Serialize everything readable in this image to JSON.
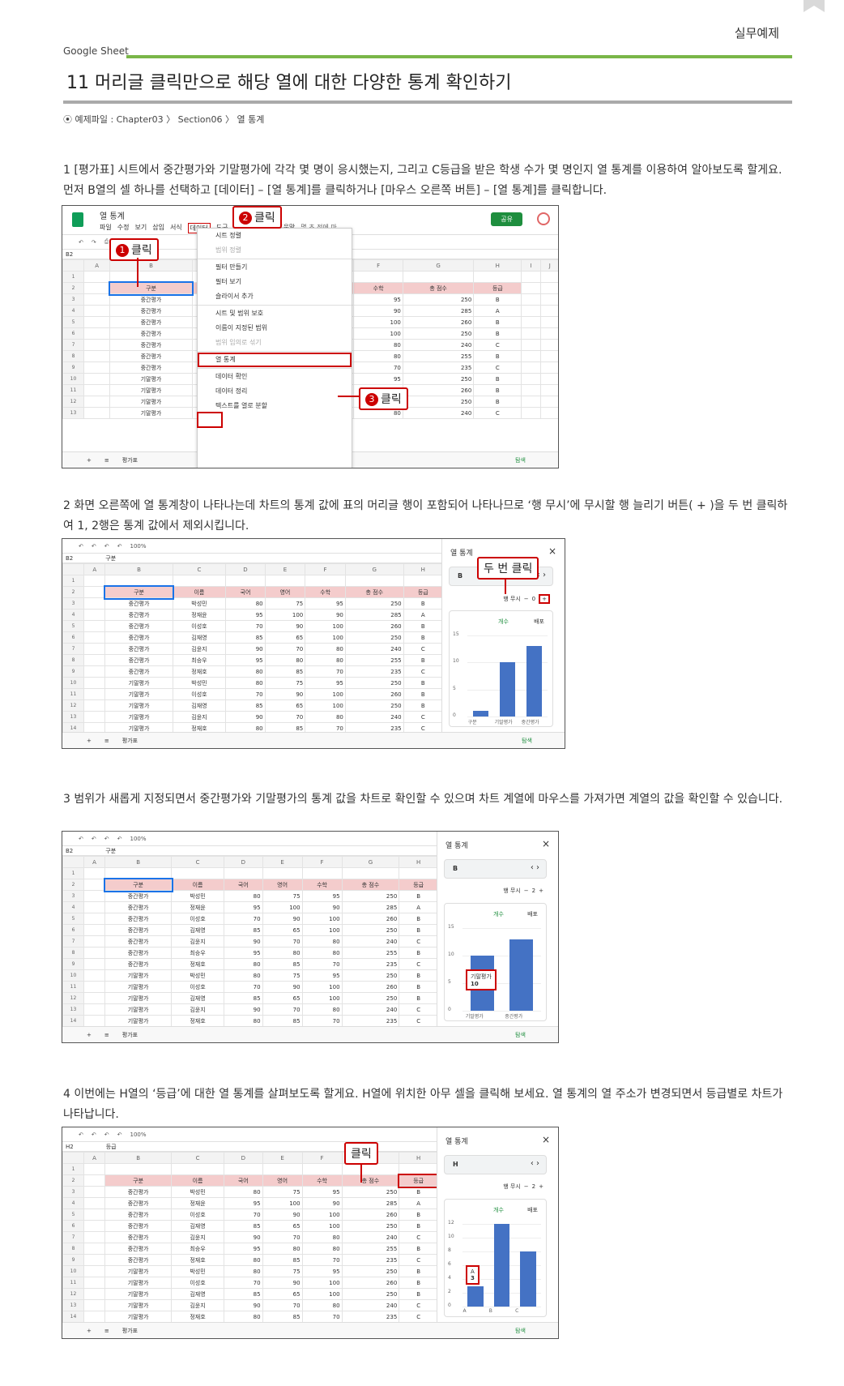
{
  "header": {
    "chapter": "실무예제",
    "app": "Google Sheet",
    "title": "11 머리글 클릭만으로 해당 열에 대한 다양한 통계 확인하기",
    "file": "⦿ 예제파일 : Chapter03 〉 Section06 〉 열 통계"
  },
  "steps": [
    "1 [평가표] 시트에서 중간평가와 기말평가에 각각 몇 명이 응시했는지, 그리고 C등급을 받은 학생 수가 몇 명인지 열 통계를 이용하여 알아보도록 할게요. 먼저 B열의 셀 하나를 선택하고 [데이터] – [열 통계]를 클릭하거나 [마우스 오른쪽 버튼] – [열 통계]를 클릭합니다.",
    "2 화면 오른쪽에 열 통계창이 나타나는데 차트의 통계 값에 표의 머리글 행이 포함되어 나타나므로 ‘행 무시’에 무시할 행 늘리기 버튼( + )을 두 번 클릭하여 1, 2행은 통계 값에서 제외시킵니다.",
    "3 범위가 새롭게 지정되면서 중간평가와 기말평가의 통계 값을 차트로 확인할 수 있으며 차트 계열에 마우스를 가져가면 계열의 값을 확인할 수 있습니다.",
    "4 이번에는 H열의 ‘등급’에 대한 열 통계를 살펴보도록 할게요. H열에 위치한 아무 셀을 클릭해 보세요. 열 통계의 열 주소가 변경되면서 등급별로 차트가 나타납니다."
  ],
  "sheet": {
    "doc_title": "열 통계",
    "menus": [
      "파일",
      "수정",
      "보기",
      "삽입",
      "서식",
      "데이터",
      "도구",
      "확장 프로그램",
      "도움말",
      "몇 초 전에 마..."
    ],
    "share": "공유",
    "tab": "평가표",
    "explore": "탐색",
    "zoom": "100%",
    "cellref1": "B2",
    "formula1": "구분",
    "cellref4": "H2",
    "formula4": "등급",
    "cols": [
      "A",
      "B",
      "C",
      "D",
      "E",
      "F",
      "G",
      "H",
      "I",
      "J"
    ],
    "headers": [
      "구분",
      "이름",
      "국어",
      "영어",
      "수학",
      "총 점수",
      "등급"
    ],
    "rows": [
      [
        "중간평가",
        "박성민",
        "80",
        "75",
        "95",
        "250",
        "B"
      ],
      [
        "중간평가",
        "정재윤",
        "95",
        "100",
        "90",
        "285",
        "A"
      ],
      [
        "중간평가",
        "이성호",
        "70",
        "90",
        "100",
        "260",
        "B"
      ],
      [
        "중간평가",
        "김재영",
        "85",
        "65",
        "100",
        "250",
        "B"
      ],
      [
        "중간평가",
        "김윤지",
        "90",
        "70",
        "80",
        "240",
        "C"
      ],
      [
        "중간평가",
        "최승우",
        "95",
        "80",
        "80",
        "255",
        "B"
      ],
      [
        "중간평가",
        "정재호",
        "80",
        "85",
        "70",
        "235",
        "C"
      ],
      [
        "기말평가",
        "박성민",
        "80",
        "75",
        "95",
        "250",
        "B"
      ],
      [
        "기말평가",
        "이성호",
        "70",
        "90",
        "100",
        "260",
        "B"
      ],
      [
        "기말평가",
        "김재영",
        "85",
        "65",
        "100",
        "250",
        "B"
      ],
      [
        "기말평가",
        "김윤지",
        "90",
        "70",
        "80",
        "240",
        "C"
      ],
      [
        "기말평가",
        "정재호",
        "80",
        "85",
        "70",
        "235",
        "C"
      ]
    ]
  },
  "menu_items": [
    "시트 정렬",
    "범위 정렬",
    "필터 만들기",
    "필터 보기",
    "슬라이서 추가",
    "시트 및 범위 보호",
    "이름이 지정된 범위",
    "범위 임의로 섞기",
    "열 통계",
    "데이터 확인",
    "데이터 정리",
    "텍스트를 열로 분할"
  ],
  "callouts": {
    "click1": "클릭",
    "click2": "클릭",
    "click3": "클릭",
    "double": "두 번 클릭",
    "click4": "클릭"
  },
  "panel": {
    "title": "열 통계",
    "colB": "B",
    "colH": "H",
    "ignore": "행 무시",
    "ignore_zero": "0",
    "ignore_two": "2",
    "count": "개수",
    "dist": "배포"
  },
  "chart2": {
    "y": [
      "15",
      "10",
      "5",
      "0"
    ],
    "x": [
      "구분",
      "기말평가",
      "중간평가"
    ]
  },
  "chart3": {
    "y": [
      "15",
      "10",
      "5",
      "0"
    ],
    "x": [
      "기말평가",
      "중간평가"
    ],
    "tip": "기말평가",
    "tipv": "10"
  },
  "chart4": {
    "y": [
      "12",
      "10",
      "8",
      "6",
      "4",
      "2",
      "0"
    ],
    "x": [
      "A",
      "B",
      "C"
    ],
    "tip": "A",
    "tipv": "3"
  },
  "chart_data": [
    {
      "type": "bar",
      "categories": [
        "구분",
        "기말평가",
        "중간평가"
      ],
      "values": [
        1,
        10,
        13
      ],
      "ylim": [
        0,
        15
      ]
    },
    {
      "type": "bar",
      "categories": [
        "기말평가",
        "중간평가"
      ],
      "values": [
        10,
        13
      ],
      "ylim": [
        0,
        15
      ]
    },
    {
      "type": "bar",
      "categories": [
        "A",
        "B",
        "C"
      ],
      "values": [
        3,
        12,
        8
      ],
      "ylim": [
        0,
        12
      ]
    }
  ],
  "colors": {
    "accent": "#7ab648",
    "callout": "#cc0000",
    "bar": "#4472c4",
    "header_fill": "#f4cccc"
  }
}
